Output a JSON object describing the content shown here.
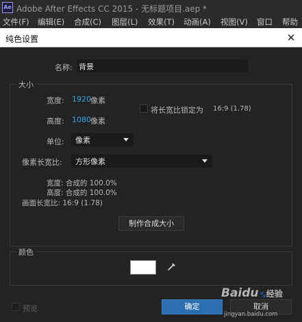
{
  "app": {
    "logo": "Ae",
    "title": "Adobe After Effects CC 2015 - 无标题项目.aep *"
  },
  "menu": [
    "文件(F)",
    "编辑(E)",
    "合成(C)",
    "图层(L)",
    "效果(T)",
    "动画(A)",
    "视图(V)",
    "窗口",
    "帮助"
  ],
  "dialog": {
    "title": "纯色设置",
    "name_label": "名称:",
    "name_value": "背景",
    "size_section": "大小",
    "width_label": "宽度:",
    "width_value": "1920",
    "width_unit": "像素",
    "height_label": "高度:",
    "height_value": "1080",
    "height_unit": "像素",
    "lock_ratio_label": "将长宽比锁定为",
    "lock_ratio_value": "16:9 (1.78)",
    "units_label": "单位:",
    "units_value": "像素",
    "pixel_aspect_label": "像素长宽比:",
    "pixel_aspect_value": "方形像素",
    "info_width": "宽度: 合成的  100.0%",
    "info_height": "高度: 合成的  100.0%",
    "info_frame": "画面长宽比: 16:9 (1.78)",
    "make_comp_size": "制作合成大小",
    "color_section": "颜色",
    "color_value": "#ffffff",
    "preview_label": "预览",
    "ok_label": "确定",
    "cancel_label": "取消"
  },
  "watermark": {
    "brand": "Baidu",
    "brand_suffix": "经验",
    "url": "jingyan.baidu.com"
  },
  "colors": {
    "accent": "#3fa5e3",
    "ok_button": "#2c6fb0",
    "background": "#232323"
  }
}
